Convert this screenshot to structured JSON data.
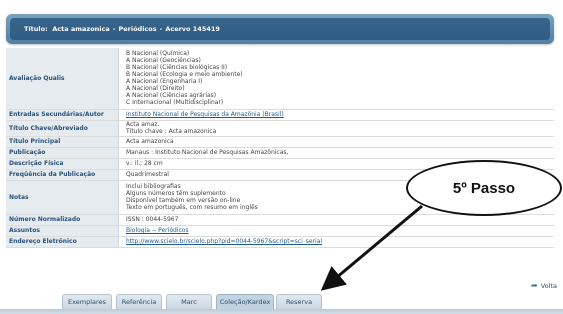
{
  "header": {
    "title_label": "Título:",
    "title_value": "Acta amazonica",
    "separator1": "-",
    "type": "Periódicos",
    "separator2": "-",
    "collection": "Acervo 145419"
  },
  "fields": [
    {
      "label": "Avaliação Qualis",
      "lines": [
        "B  Nacional  (Química)",
        "A  Nacional  (Geociências)",
        "B  Nacional  (Ciências biológicas II)",
        "B  Nacional  (Ecologia e meio ambiente)",
        "A  Nacional  (Engenharia I)",
        "A  Nacional  (Direito)",
        "A  Nacional  (Ciências agrárias)",
        "C  Internacional  (Multidisciplinar)"
      ]
    },
    {
      "label": "Entradas Secundárias/Autor",
      "lines": [
        "Instituto Nacional de Pesquisas da Amazônia (Brasil)"
      ],
      "link": true
    },
    {
      "label": "Título Chave/Abreviado",
      "lines": [
        "Acta amaz.",
        "Título chave : Acta amazonica"
      ]
    },
    {
      "label": "Título Principal",
      "lines": [
        "Acta amazonica"
      ]
    },
    {
      "label": "Publicação",
      "lines": [
        "Manaus : Instituto Nacional de Pesquisas Amazônicas,"
      ]
    },
    {
      "label": "Descrição Física",
      "lines": [
        "v.: il.; 28 cm"
      ]
    },
    {
      "label": "Freqüência da Publicação",
      "lines": [
        "Quadrimestral"
      ]
    },
    {
      "label": "Notas",
      "lines": [
        "Inclui bibliografias",
        "Alguns números têm suplemento",
        "Disponível também em versão on-line",
        "Texto em português, com resumo em inglês"
      ]
    },
    {
      "label": "Número Normalizado",
      "lines": [
        "ISSN : 0044-5967"
      ]
    },
    {
      "label": "Assuntos",
      "lines": [
        "Biologia -- Periódicos"
      ],
      "link": true
    },
    {
      "label": "Endereço Eletrônico",
      "lines": [
        "http://www.scielo.br/scielo.php?pid=0044-5967&script=sci_serial"
      ],
      "link": true
    }
  ],
  "callout": {
    "text": "5º Passo"
  },
  "voltar": {
    "label": "Volta",
    "icon": "back-arrow-icon"
  },
  "tabs": [
    "Exemplares",
    "Referência",
    "Marc",
    "Coleção/Kardex",
    "Reserva"
  ],
  "colors": {
    "header_bg": "#36648b",
    "label_bg": "#e6ebef",
    "label_text": "#29517a",
    "link": "#1f5b8e"
  }
}
